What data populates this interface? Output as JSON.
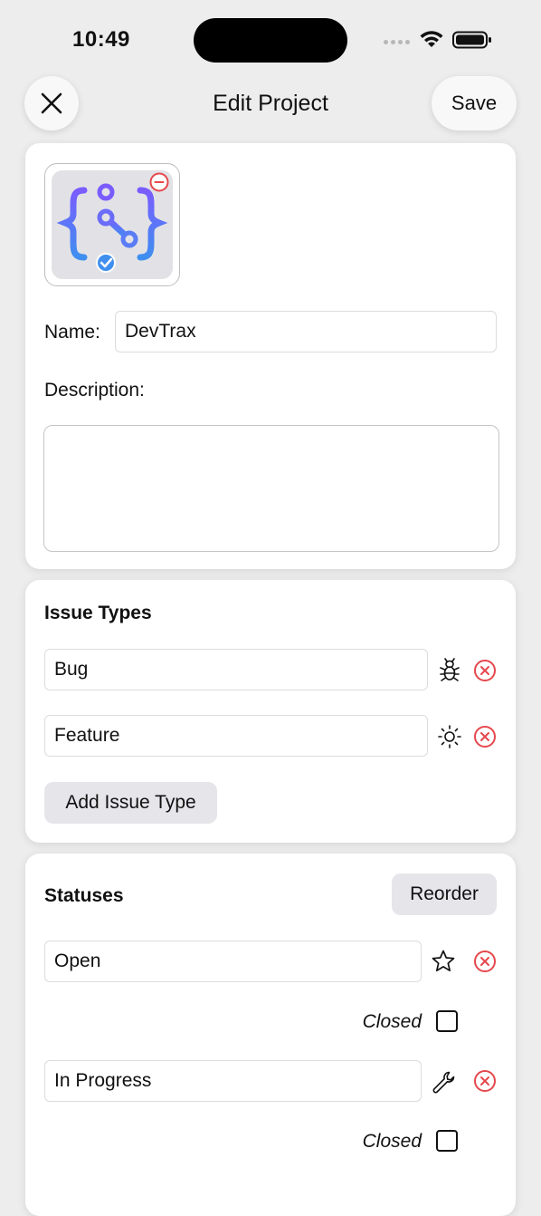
{
  "status_bar": {
    "time": "10:49"
  },
  "nav": {
    "title": "Edit Project",
    "save_label": "Save"
  },
  "project": {
    "name_label": "Name:",
    "name_value": "DevTrax",
    "description_label": "Description:",
    "description_value": ""
  },
  "issue_types": {
    "title": "Issue Types",
    "items": [
      {
        "name": "Bug",
        "icon": "ant-icon"
      },
      {
        "name": "Feature",
        "icon": "sun-icon"
      }
    ],
    "add_label": "Add Issue Type"
  },
  "statuses": {
    "title": "Statuses",
    "reorder_label": "Reorder",
    "items": [
      {
        "name": "Open",
        "icon": "star-icon",
        "closed_label": "Closed",
        "closed": false
      },
      {
        "name": "In Progress",
        "icon": "wrench-icon",
        "closed_label": "Closed",
        "closed": false
      }
    ]
  },
  "colors": {
    "accent_red": "#e5484d",
    "icon_purple": "#7a5cff",
    "icon_blue": "#3f8ff0"
  }
}
